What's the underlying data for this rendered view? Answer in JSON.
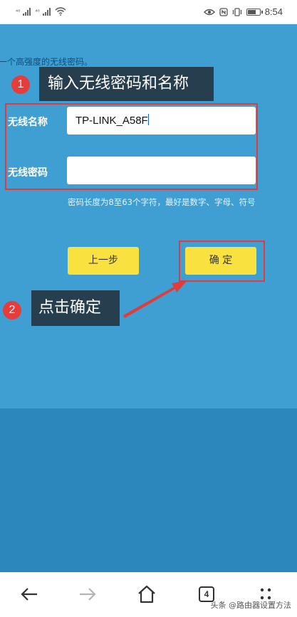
{
  "status_bar": {
    "time": "8:54",
    "carrier_tag_1": "⁴⁶",
    "carrier_tag_2": "⁴⁶"
  },
  "page": {
    "top_hint": "一个高强度的无线密码。",
    "step1": {
      "number": "1",
      "text": "输入无线密码和名称"
    },
    "step2": {
      "number": "2",
      "text": "点击确定"
    },
    "ssid": {
      "label": "无线名称",
      "value": "TP-LINK_A58F"
    },
    "password": {
      "label": "无线密码",
      "value": ""
    },
    "password_hint": "密码长度为8至63个字符，最好是数字、字母、符号",
    "prev_button": "上一步",
    "confirm_button": "确 定"
  },
  "nav": {
    "tab_count": "4",
    "watermark": "头条 @路由器设置方法"
  },
  "colors": {
    "page_bg": "#3f9fd2",
    "page_lower_bg": "#2b87bc",
    "button_yellow": "#f9e240",
    "highlight_red": "#e23b3b",
    "callout_bg": "#273e4e"
  }
}
